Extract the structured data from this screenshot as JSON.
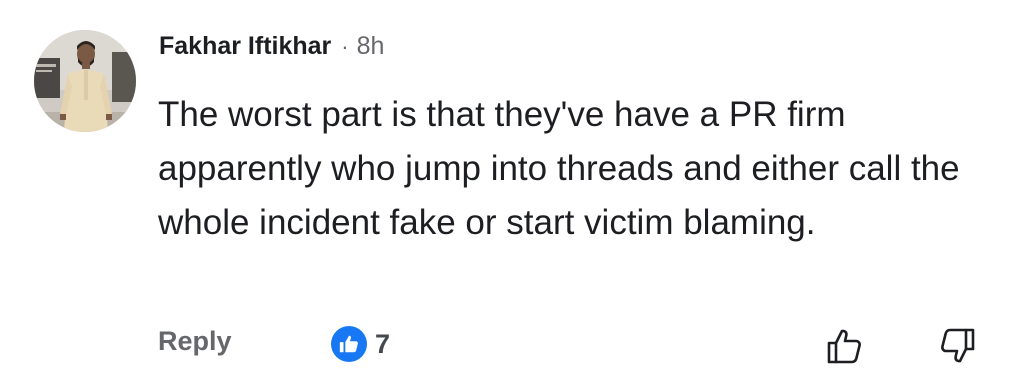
{
  "comment": {
    "author": "Fakhar Iftikhar",
    "separator": "·",
    "timestamp": "8h",
    "text": "The worst part is that they've have a PR firm apparently who jump into threads and either call the whole incident fake or start victim blaming.",
    "reply_label": "Reply",
    "reaction_count": "7",
    "reaction_icon": "like-icon",
    "upvote_icon": "thumbs-up-icon",
    "downvote_icon": "thumbs-down-icon"
  },
  "colors": {
    "primary_text": "#1c1e21",
    "secondary_text": "#65676b",
    "like_blue": "#1877f2"
  }
}
